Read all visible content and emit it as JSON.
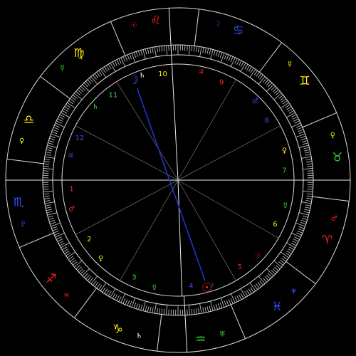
{
  "background": "#000000",
  "colors": {
    "red": "#ff2020",
    "yellow": "#ffee00",
    "green": "#33dd33",
    "blue": "#3355ff",
    "white": "#ffffff",
    "line": "#dddddd",
    "aspect": "#2233cc"
  },
  "signs": [
    {
      "glyph": "♉",
      "name": "taurus",
      "element": "green"
    },
    {
      "glyph": "♊",
      "name": "gemini",
      "element": "yellow"
    },
    {
      "glyph": "♋",
      "name": "cancer",
      "element": "blue"
    },
    {
      "glyph": "♌",
      "name": "leo",
      "element": "red"
    },
    {
      "glyph": "♍",
      "name": "virgo",
      "element": "yellow"
    },
    {
      "glyph": "♎",
      "name": "libra",
      "element": "yellow"
    },
    {
      "glyph": "♏",
      "name": "scorpio",
      "element": "blue"
    },
    {
      "glyph": "♐",
      "name": "sagittarius",
      "element": "red"
    },
    {
      "glyph": "♑",
      "name": "capricorn",
      "element": "yellow"
    },
    {
      "glyph": "♒",
      "name": "aquarius",
      "element": "green"
    },
    {
      "glyph": "♓",
      "name": "pisces",
      "element": "blue"
    },
    {
      "glyph": "♈",
      "name": "aries",
      "element": "red"
    }
  ],
  "sign_rulers": [
    {
      "glyph": "♀",
      "color": "yellow"
    },
    {
      "glyph": "☿",
      "color": "yellow"
    },
    {
      "glyph": "☽",
      "color": "blue"
    },
    {
      "glyph": "☉",
      "color": "red"
    },
    {
      "glyph": "☿",
      "color": "green"
    },
    {
      "glyph": "♀",
      "color": "yellow"
    },
    {
      "glyph": "♇",
      "color": "blue"
    },
    {
      "glyph": "♃",
      "color": "red"
    },
    {
      "glyph": "♄",
      "color": "white"
    },
    {
      "glyph": "♅",
      "color": "green"
    },
    {
      "glyph": "♆",
      "color": "blue"
    },
    {
      "glyph": "♂",
      "color": "red"
    }
  ],
  "houses": [
    {
      "number": "1",
      "color": "red",
      "ruler": "♂",
      "ruler_color": "red"
    },
    {
      "number": "2",
      "color": "yellow",
      "ruler": "♀",
      "ruler_color": "yellow"
    },
    {
      "number": "3",
      "color": "green",
      "ruler": "☿",
      "ruler_color": "green"
    },
    {
      "number": "4",
      "color": "blue",
      "ruler": "☽",
      "ruler_color": "blue"
    },
    {
      "number": "5",
      "color": "red",
      "ruler": "☉",
      "ruler_color": "red"
    },
    {
      "number": "6",
      "color": "yellow",
      "ruler": "☿",
      "ruler_color": "green"
    },
    {
      "number": "7",
      "color": "green",
      "ruler": "♀",
      "ruler_color": "yellow"
    },
    {
      "number": "8",
      "color": "blue",
      "ruler": "♂",
      "ruler_color": "blue"
    },
    {
      "number": "9",
      "color": "red",
      "ruler": "♃",
      "ruler_color": "red"
    },
    {
      "number": "10",
      "color": "yellow",
      "ruler": "♄",
      "ruler_color": "white"
    },
    {
      "number": "11",
      "color": "green",
      "ruler": "♄",
      "ruler_color": "green"
    },
    {
      "number": "12",
      "color": "blue",
      "ruler": "♃",
      "ruler_color": "blue"
    }
  ],
  "planets": [
    {
      "name": "moon",
      "glyph": "☽",
      "color": "blue"
    },
    {
      "name": "sun",
      "glyph": "☉",
      "color": "red"
    }
  ]
}
